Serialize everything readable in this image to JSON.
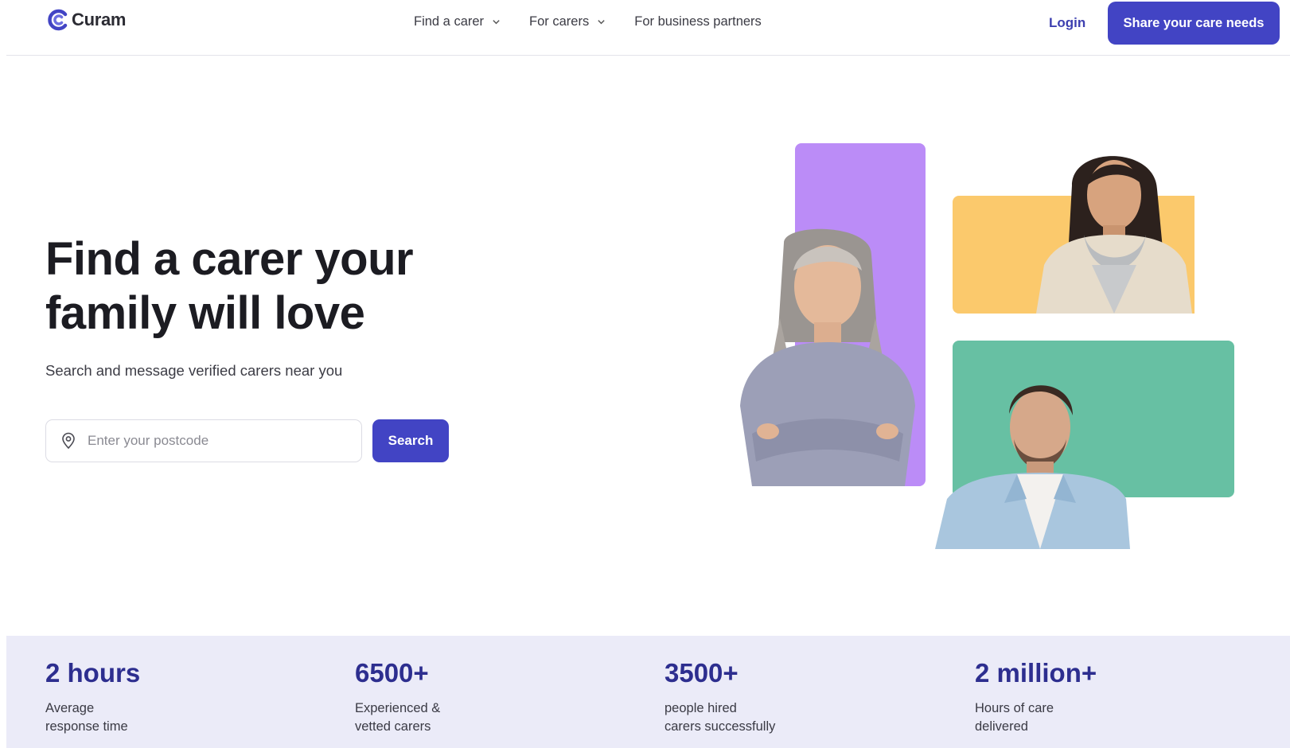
{
  "brand": {
    "name": "Curam",
    "accent": "#4244c4",
    "stat_color": "#2d2e8f"
  },
  "nav": {
    "items": [
      {
        "label": "Find a carer",
        "has_dropdown": true,
        "icon": "chevron-down-icon"
      },
      {
        "label": "For carers",
        "has_dropdown": true,
        "icon": "chevron-down-icon"
      },
      {
        "label": "For business partners",
        "has_dropdown": false
      }
    ],
    "login_label": "Login",
    "cta_label": "Share your care needs"
  },
  "hero": {
    "title_line1": "Find a carer your",
    "title_line2": "family will love",
    "subtitle": "Search and message verified carers near you",
    "search": {
      "placeholder": "Enter your postcode",
      "value": "",
      "icon": "location-pin-icon",
      "button_label": "Search"
    }
  },
  "collage": {
    "colors": {
      "purple": "#bb8cf7",
      "yellow": "#fbc96c",
      "green": "#67c0a3"
    },
    "photos": [
      "older-woman-carer-photo",
      "young-woman-carer-photo",
      "young-man-carer-photo"
    ]
  },
  "stats": [
    {
      "value": "2 hours",
      "label_line1": "Average",
      "label_line2": "response time"
    },
    {
      "value": "6500+",
      "label_line1": "Experienced &",
      "label_line2": "vetted carers"
    },
    {
      "value": "3500+",
      "label_line1": "people hired",
      "label_line2": "carers successfully"
    },
    {
      "value": "2 million+",
      "label_line1": "Hours of care",
      "label_line2": "delivered"
    }
  ]
}
